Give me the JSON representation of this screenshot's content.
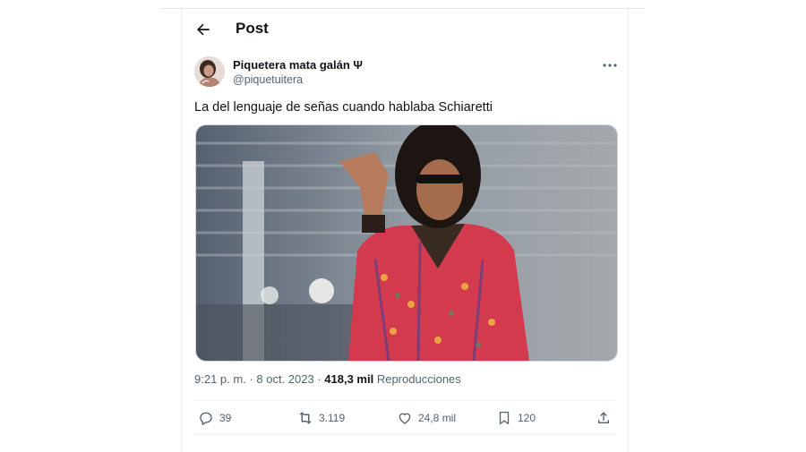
{
  "header": {
    "title": "Post",
    "back_icon": "arrow-left-icon"
  },
  "author": {
    "name": "Piquetera mata galán Ψ",
    "handle": "@piquetuitera"
  },
  "post": {
    "text": "La del lenguaje de señas cuando hablaba Schiaretti",
    "time": "9:21 p. m.",
    "sep1": " · ",
    "date": "8 oct. 2023",
    "sep2": " · ",
    "views_count": "418,3 mil",
    "views_label": "Reproducciones"
  },
  "actions": {
    "replies": "39",
    "reposts": "3.119",
    "likes": "24,8 mil",
    "bookmarks": "120"
  },
  "colors": {
    "text": "#0f1419",
    "secondary": "#536471",
    "border": "#eff3f4"
  }
}
